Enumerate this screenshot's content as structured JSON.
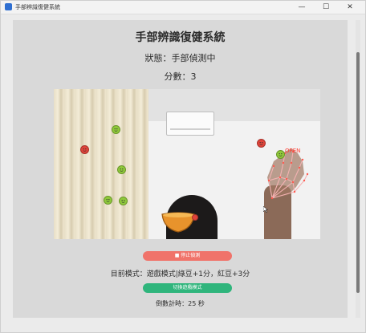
{
  "window": {
    "title": "手部辨識復健系統",
    "controls": {
      "minimize": "—",
      "maximize": "☐",
      "close": "✕"
    }
  },
  "app": {
    "title": "手部辨識復健系統",
    "status": "狀態：手部偵測中",
    "score": "分數：3"
  },
  "camera": {
    "gesture_label": "OPEN",
    "beans": [
      {
        "color": "red"
      },
      {
        "color": "green"
      },
      {
        "color": "green"
      },
      {
        "color": "green"
      },
      {
        "color": "green"
      },
      {
        "color": "red"
      },
      {
        "color": "green"
      },
      {
        "color": "red"
      }
    ]
  },
  "controls": {
    "stop_button": "■ 停止偵測",
    "mode_text": "目前模式：遊戲模式|綠豆+1分，紅豆+3分",
    "switch_button": "切換遊戲模式",
    "countdown": "倒數計時：25 秒"
  },
  "colors": {
    "stop_button": "#f0736a",
    "switch_button": "#2fb57c",
    "green_bean": "#8fc93a",
    "red_bean": "#e0443a"
  }
}
